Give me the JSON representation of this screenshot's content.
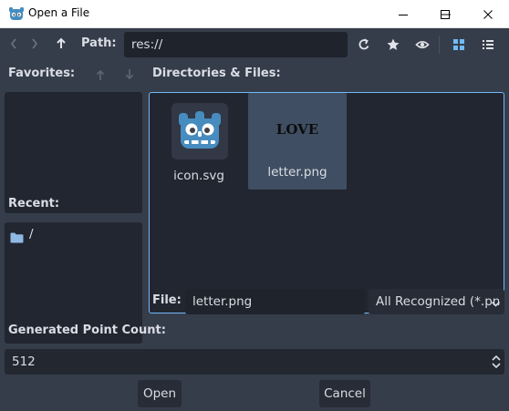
{
  "window": {
    "title": "Open a File"
  },
  "toolbar": {
    "path_label": "Path:",
    "path_value": "res://"
  },
  "favorites": {
    "label": "Favorites:"
  },
  "recent": {
    "label": "Recent:",
    "items": [
      {
        "label": "/",
        "icon": "folder-icon"
      }
    ]
  },
  "files": {
    "label": "Directories & Files:",
    "items": [
      {
        "name": "icon.svg",
        "thumbnail": "godot-logo"
      },
      {
        "name": "letter.png",
        "thumbnail_text": "LOVE",
        "selected": true
      }
    ]
  },
  "file_row": {
    "label": "File:",
    "value": "letter.png",
    "filter": "All Recognized (*.pn"
  },
  "option": {
    "label": "Generated Point Count:",
    "value": "512"
  },
  "buttons": {
    "open": "Open",
    "cancel": "Cancel"
  },
  "colors": {
    "background": "#363d4a",
    "panel": "#222630",
    "field": "#1f232b",
    "accent": "#70bafa",
    "selection": "#3f4e62",
    "text": "#d9dde4",
    "godot_blue": "#478cbf"
  }
}
